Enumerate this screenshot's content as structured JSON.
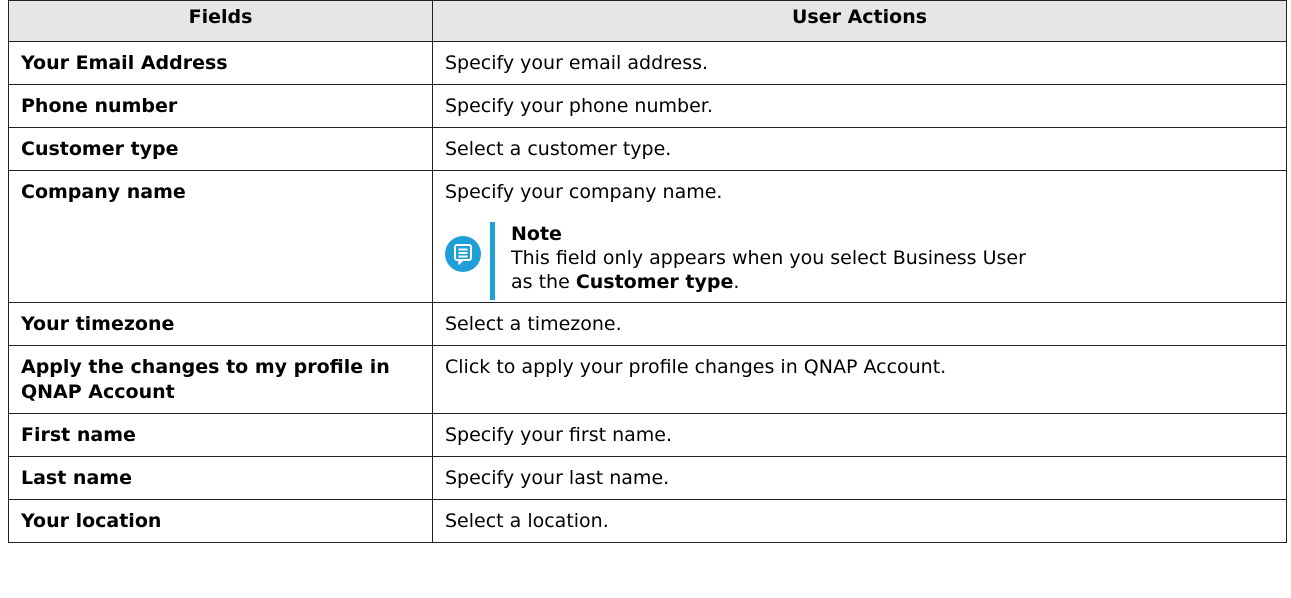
{
  "table": {
    "headers": [
      "Fields",
      "User Actions"
    ],
    "rows": [
      {
        "field": "Your Email Address",
        "action": "Specify your email address."
      },
      {
        "field": "Phone number",
        "action": "Specify your phone number."
      },
      {
        "field": "Customer type",
        "action": "Select a customer type."
      },
      {
        "field": "Company name",
        "action": "Specify your company name."
      },
      {
        "field": "Your timezone",
        "action": "Select a timezone."
      },
      {
        "field": "Apply the changes to my profile in QNAP Account",
        "action": "Click to apply your profile changes in QNAP Account."
      },
      {
        "field": "First name",
        "action": "Specify your first name."
      },
      {
        "field": "Last name",
        "action": "Specify your last name."
      },
      {
        "field": "Your location",
        "action": "Select a location."
      }
    ]
  },
  "note": {
    "icon": "note-icon",
    "title": "Note",
    "text_line1": "This field only appears when you select Business User",
    "text_line2_prefix": "as the ",
    "text_line2_bold": "Customer type",
    "text_line2_suffix": ".",
    "accent_color": "#1e9fd8"
  }
}
